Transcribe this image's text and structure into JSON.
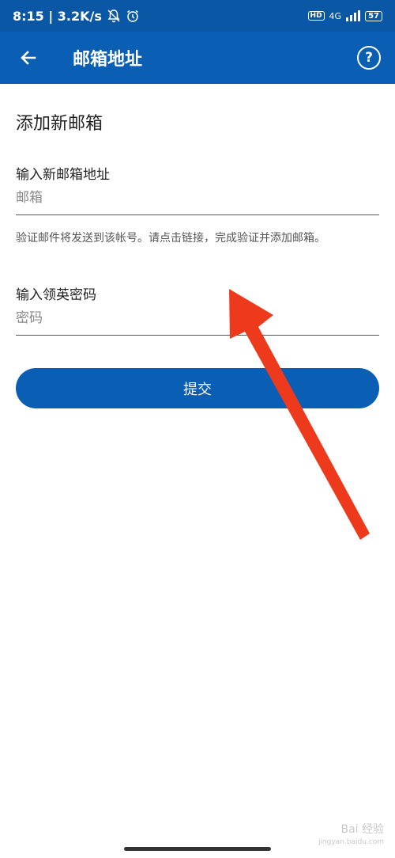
{
  "status_bar": {
    "time_network": "8:15 | 3.2K/s",
    "hd": "HD",
    "network_type": "4G",
    "battery": "57"
  },
  "app_bar": {
    "title": "邮箱地址"
  },
  "form": {
    "heading": "添加新邮箱",
    "email_label": "输入新邮箱地址",
    "email_placeholder": "邮箱",
    "hint": "验证邮件将发送到该帐号。请点击链接，完成验证并添加邮箱。",
    "password_label": "输入领英密码",
    "password_placeholder": "密码",
    "submit_label": "提交"
  },
  "watermark": {
    "brand": "Bai 经验",
    "url": "jingyan.baidu.com"
  },
  "colors": {
    "status_bar": "#0a57a6",
    "app_bar": "#0a5fb4",
    "button": "#0a5fb4",
    "annotation_arrow": "#ee3a1c"
  }
}
